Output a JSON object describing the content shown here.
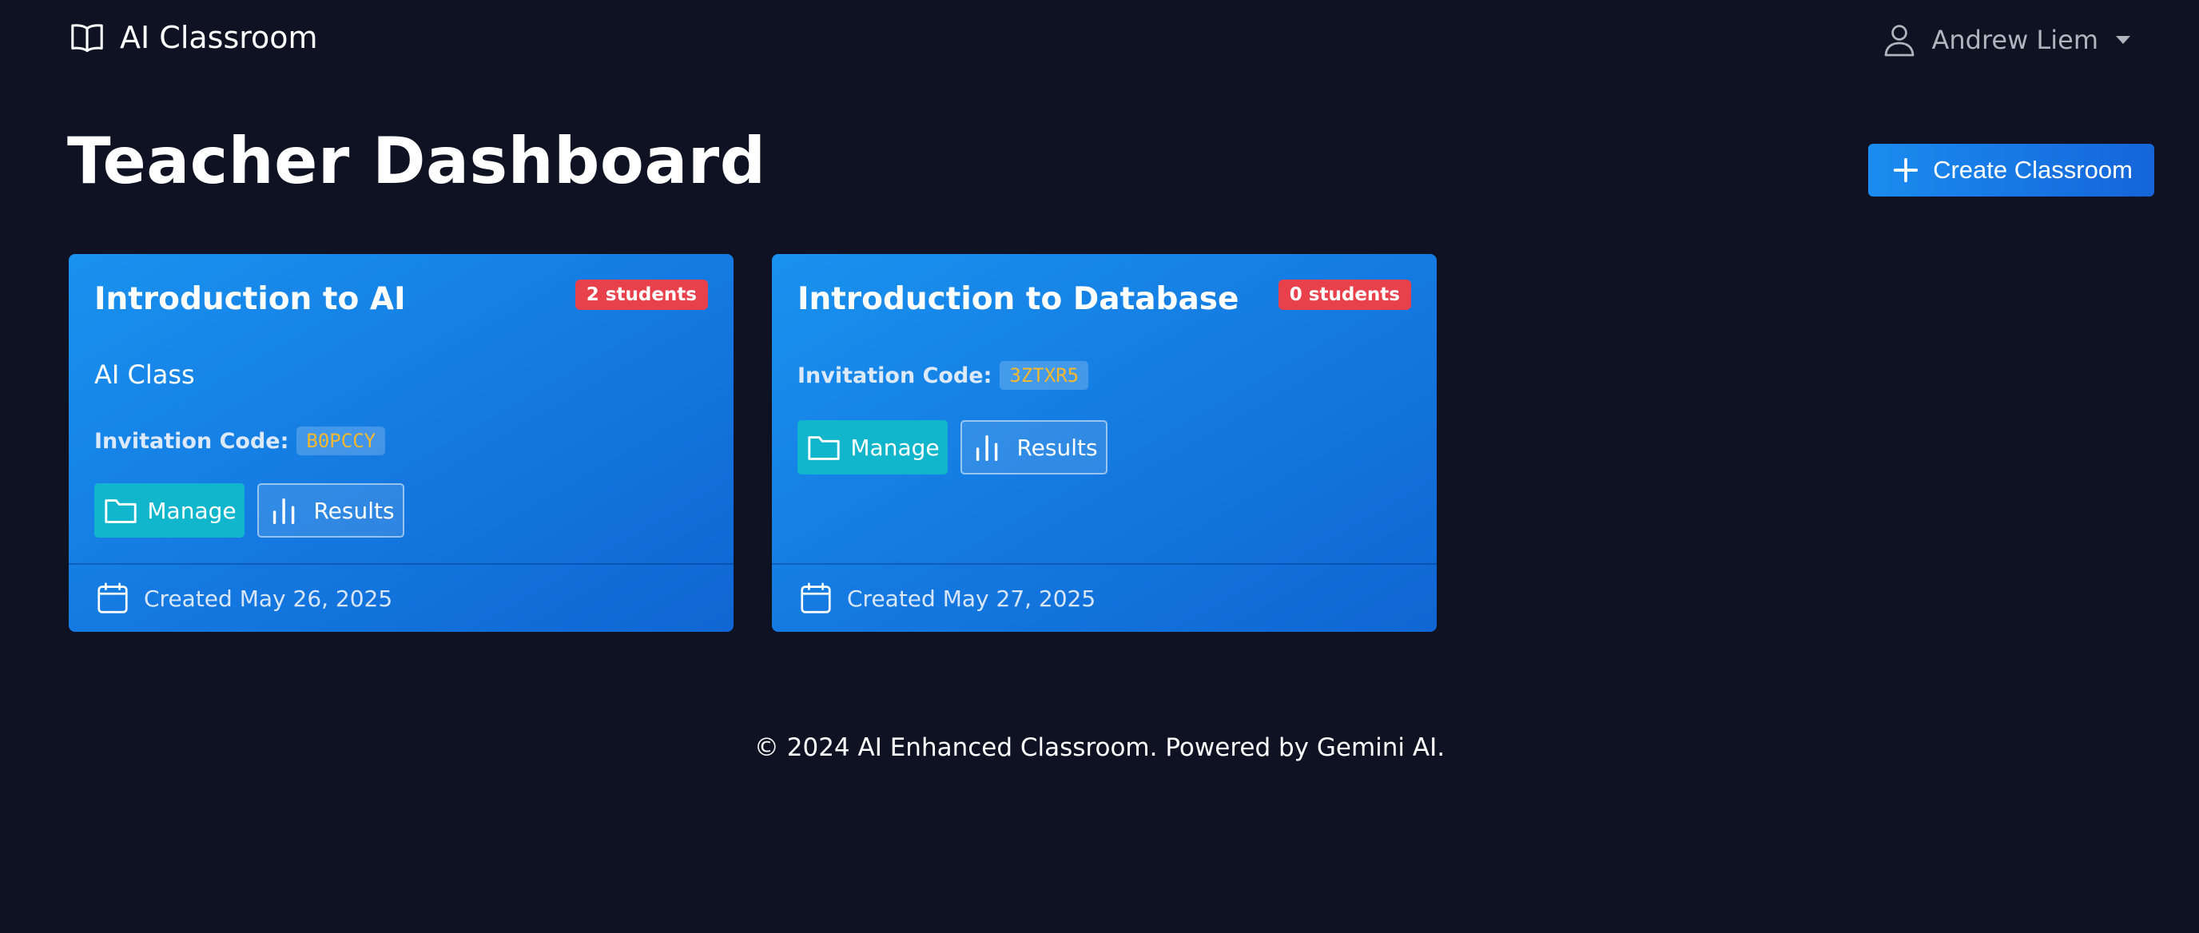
{
  "navbar": {
    "brand": "AI Classroom",
    "brand_icon": "book-open-icon",
    "user_name": "Andrew Liem",
    "user_icon": "person-icon"
  },
  "header": {
    "title": "Teacher Dashboard",
    "create_button_label": "Create Classroom"
  },
  "classrooms": [
    {
      "title": "Introduction to AI",
      "student_badge": "2 students",
      "description": "AI Class",
      "invitation_label": "Invitation Code:",
      "invitation_code": "B0PCCY",
      "manage_label": "Manage",
      "results_label": "Results",
      "created": "Created May 26, 2025"
    },
    {
      "title": "Introduction to Database",
      "student_badge": "0 students",
      "description": "",
      "invitation_label": "Invitation Code:",
      "invitation_code": "3ZTXR5",
      "manage_label": "Manage",
      "results_label": "Results",
      "created": "Created May 27, 2025"
    }
  ],
  "footer": {
    "text": "© 2024 AI Enhanced Classroom. Powered by Gemini AI."
  },
  "colors": {
    "background": "#0e1222",
    "card": "#1478e0",
    "badge": "#e8414b",
    "manage_button": "#12b6cc",
    "invitation_code": "#f5b82e",
    "primary_button": "#1a8cf0"
  }
}
